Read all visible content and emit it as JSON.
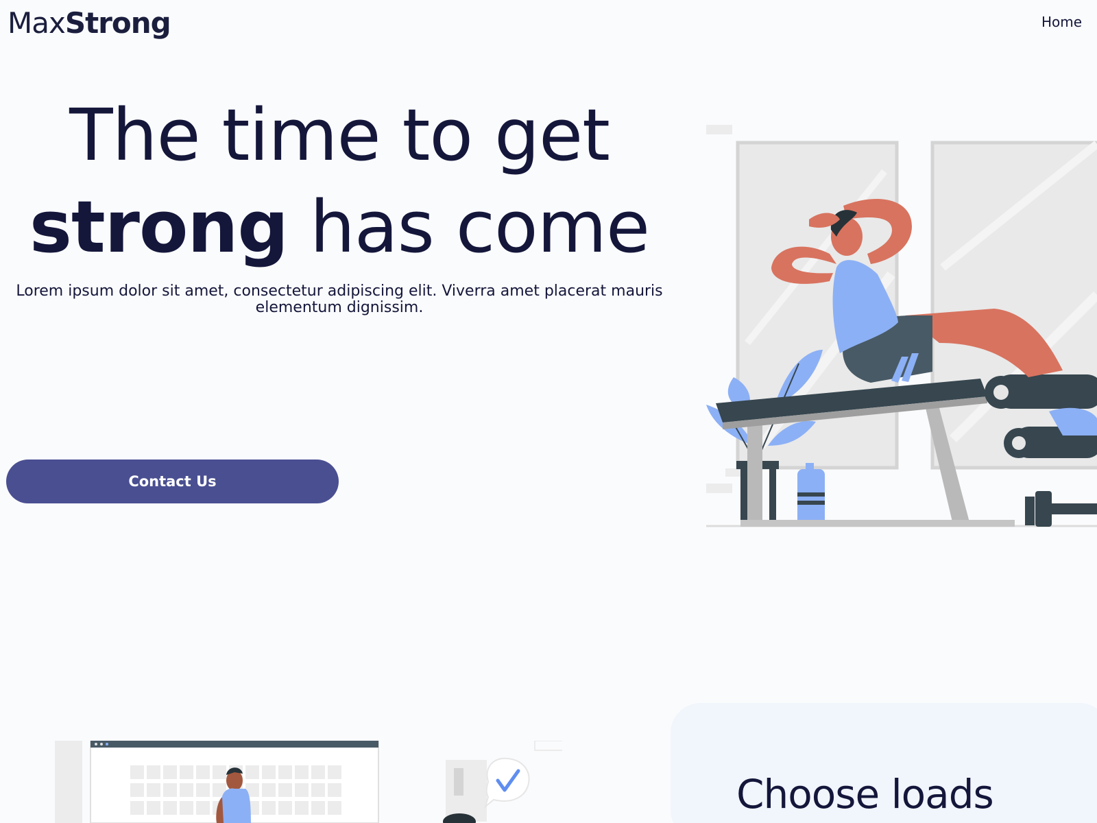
{
  "header": {
    "logo_light": "Max",
    "logo_bold": "Strong",
    "nav": {
      "home_label": "Home"
    }
  },
  "hero": {
    "title_line1": "The time to get",
    "title_strong": "strong",
    "title_line2_rest": " has come",
    "subtitle": "Lorem ipsum dolor sit amet, consectetur adipiscing elit. Viverra amet placerat mauris elementum dignissim.",
    "cta_label": "Contact Us"
  },
  "features": {
    "card_title": "Choose loads"
  },
  "colors": {
    "primary": "#4a4f91",
    "text": "#14163a",
    "illustration_accent": "#8cb0f5",
    "skin": "#d8735f",
    "bench": "#37464f"
  },
  "icons": {
    "hero_illustration": "man-doing-situps-illustration",
    "bottom_illustration": "workout-planner-illustration",
    "check_icon": "check-bubble-icon"
  }
}
